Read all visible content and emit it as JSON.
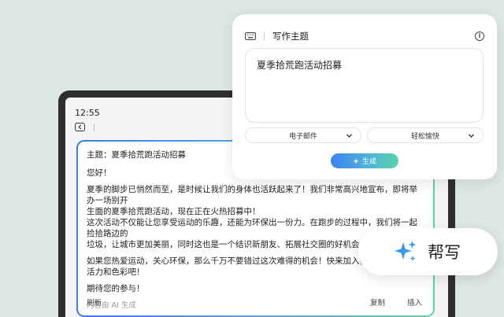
{
  "status": {
    "time": "12:55"
  },
  "editor": {
    "subject": "主题：夏季拾荒跑活动招募",
    "greeting": "您好！",
    "para1_line1": "夏季的脚步已悄然而至，是时候让我们的身体也活跃起来了！我们非常高兴地宣布，即将举办一场别开",
    "para1_line2": "生面的夏季拾荒跑活动，现在正在火热招募中！",
    "para1_line3": "这次活动不仅能让您享受运动的乐趣，还能为环保出一份力。在跑步的过程中，我们将一起捡拾路边的",
    "para1_line4": "垃圾，让城市更加美丽，同时这也是一个结识新朋友、拓展社交圈的好机会。",
    "para2_line1": "如果您热爱运动，关心环保，那么千万不要错过这次难得的机会！快来加入我们，一起",
    "para2_line2": "活力和色彩吧！",
    "closing": "期待您的参与！",
    "ai_note": "内容由 AI 生成",
    "actions": {
      "refresh": "刷新",
      "copy": "复制",
      "insert": "插入"
    }
  },
  "panel": {
    "title": "写作主题",
    "topic_value": "夏季拾荒跑活动招募",
    "type_select": "电子邮件",
    "tone_select": "轻松愉快",
    "generate_label": "生成"
  },
  "help_pill": {
    "label": "帮写"
  },
  "colors": {
    "accent_blue": "#3b7dea",
    "accent_green": "#5bd6a0",
    "background": "#dde7e5"
  }
}
